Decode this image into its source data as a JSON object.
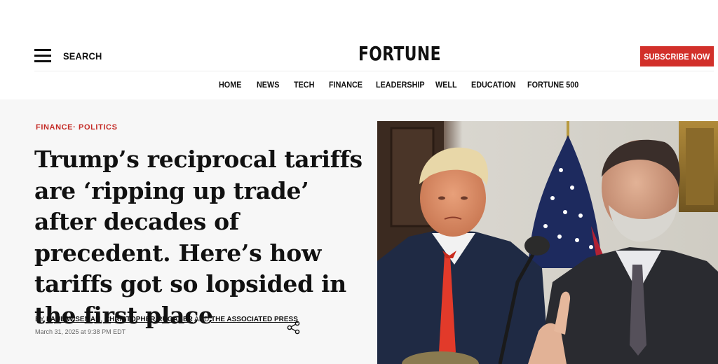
{
  "header": {
    "search_label": "SEARCH",
    "logo": "FORTUNE",
    "subscribe_label": "SUBSCRIBE NOW",
    "accent_color": "#d2302a"
  },
  "nav": {
    "items": [
      "HOME",
      "NEWS",
      "TECH",
      "FINANCE",
      "LEADERSHIP",
      "WELL",
      "EDUCATION",
      "FORTUNE 500"
    ]
  },
  "article": {
    "kicker_1": "FINANCE",
    "kicker_sep": "· ",
    "kicker_2": "POLITICS",
    "headline": "Trump’s reciprocal tariffs are ‘ripping up trade’ after decades of precedent. Here’s how tariffs got so lopsided in the first place",
    "by": "BY ",
    "author_1": "PAUL WISEMAN",
    "comma": ", ",
    "author_2": "CHRISTOPHER RUGABER",
    "and": " AND ",
    "author_3": "THE ASSOCIATED PRESS",
    "date": "March 31, 2025 at 9:38 PM EDT",
    "share_icon": "share-icon"
  }
}
